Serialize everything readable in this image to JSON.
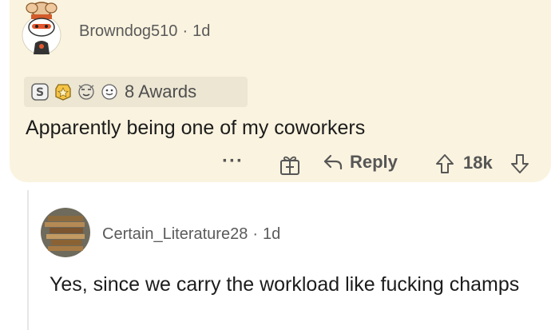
{
  "comments": [
    {
      "author": "Browndog510",
      "separator": "·",
      "age": "1d",
      "awards_label": "8 Awards",
      "awards": [
        "silver-award-icon",
        "gold-award-icon",
        "starstruck-award-icon",
        "wholesome-award-icon"
      ],
      "body": "Apparently being one of my coworkers",
      "more_label": "···",
      "reply_label": "Reply",
      "score": "18k",
      "background": "#faf3df"
    },
    {
      "author": "Certain_Literature28",
      "separator": "·",
      "age": "1d",
      "body": "Yes, since we carry the workload like fucking champs"
    }
  ]
}
